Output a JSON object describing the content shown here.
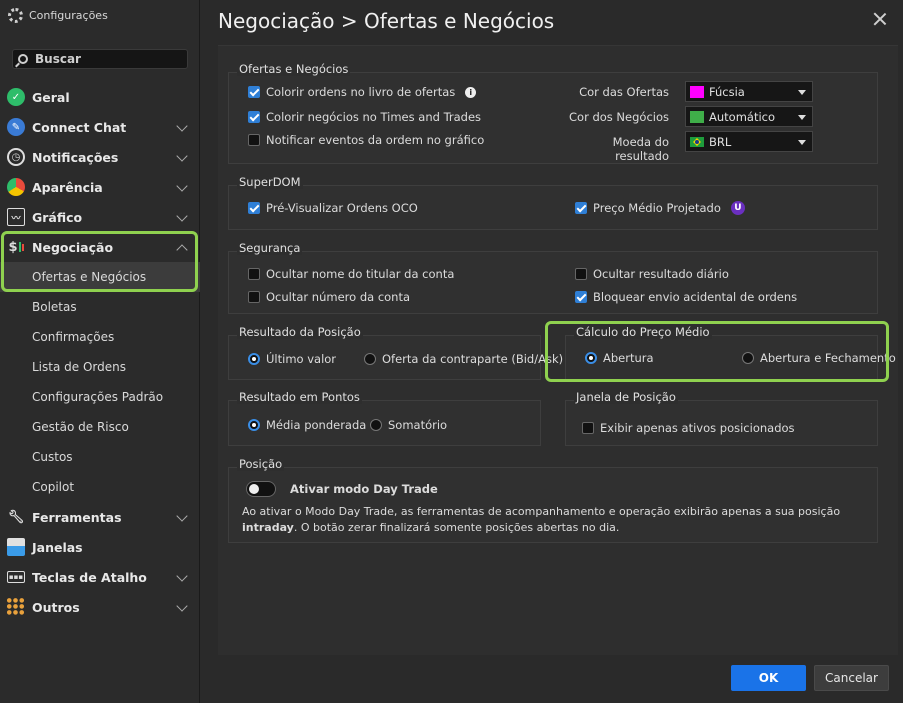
{
  "sidebar": {
    "app_title": "Configurações",
    "search_label": "Buscar",
    "items": [
      {
        "label": "Geral"
      },
      {
        "label": "Connect Chat"
      },
      {
        "label": "Notificações"
      },
      {
        "label": "Aparência"
      },
      {
        "label": "Gráfico"
      },
      {
        "label": "Negociação"
      },
      {
        "label": "Ferramentas"
      },
      {
        "label": "Janelas"
      },
      {
        "label": "Teclas de Atalho"
      },
      {
        "label": "Outros"
      }
    ],
    "negociacao_sub": [
      {
        "label": "Ofertas e Negócios"
      },
      {
        "label": "Boletas"
      },
      {
        "label": "Confirmações"
      },
      {
        "label": "Lista de Ordens"
      },
      {
        "label": "Configurações Padrão"
      },
      {
        "label": "Gestão de Risco"
      },
      {
        "label": "Custos"
      },
      {
        "label": "Copilot"
      }
    ],
    "highlight_color": "#8fd14f"
  },
  "header": {
    "title": "Negociação > Ofertas e Negócios"
  },
  "ofertas": {
    "title": "Ofertas e Negócios",
    "opt1": "Colorir ordens no livro de ofertas",
    "opt2": "Colorir negócios no Times and Trades",
    "opt3": "Notificar eventos da ordem no gráfico",
    "cor_ofertas_label": "Cor das Ofertas",
    "cor_ofertas_value": "Fúcsia",
    "cor_ofertas_color": "#ff00ff",
    "cor_negocios_label": "Cor dos Negócios",
    "cor_negocios_value": "Automático",
    "cor_negocios_color": "#3fae49",
    "moeda_label": "Moeda do resultado",
    "moeda_value": "BRL"
  },
  "superdom": {
    "title": "SuperDOM",
    "opt1": "Pré-Visualizar Ordens OCO",
    "opt2": "Preço Médio Projetado",
    "badge": "U"
  },
  "seguranca": {
    "title": "Segurança",
    "opt1": "Ocultar nome do titular da conta",
    "opt2": "Ocultar número da conta",
    "opt3": "Ocultar resultado diário",
    "opt4": "Bloquear envio acidental de ordens"
  },
  "resultado_posicao": {
    "title": "Resultado da Posição",
    "opt1": "Último valor",
    "opt2": "Oferta da contraparte (Bid/Ask)"
  },
  "calculo": {
    "title": "Cálculo do Preço Médio",
    "opt1": "Abertura",
    "opt2": "Abertura e Fechamento"
  },
  "resultado_pontos": {
    "title": "Resultado em Pontos",
    "opt1": "Média ponderada",
    "opt2": "Somatório"
  },
  "janela_posicao": {
    "title": "Janela de Posição",
    "opt1": "Exibir apenas ativos posicionados"
  },
  "posicao": {
    "title": "Posição",
    "toggle_label": "Ativar modo Day Trade",
    "desc_line1": "Ao ativar o Modo Day Trade, as ferramentas de acompanhamento e operação exibirão apenas a sua posição",
    "desc_bold": "intraday",
    "desc_line2": ". O botão zerar finalizará somente posições abertas no dia."
  },
  "footer": {
    "ok": "OK",
    "cancel": "Cancelar"
  }
}
